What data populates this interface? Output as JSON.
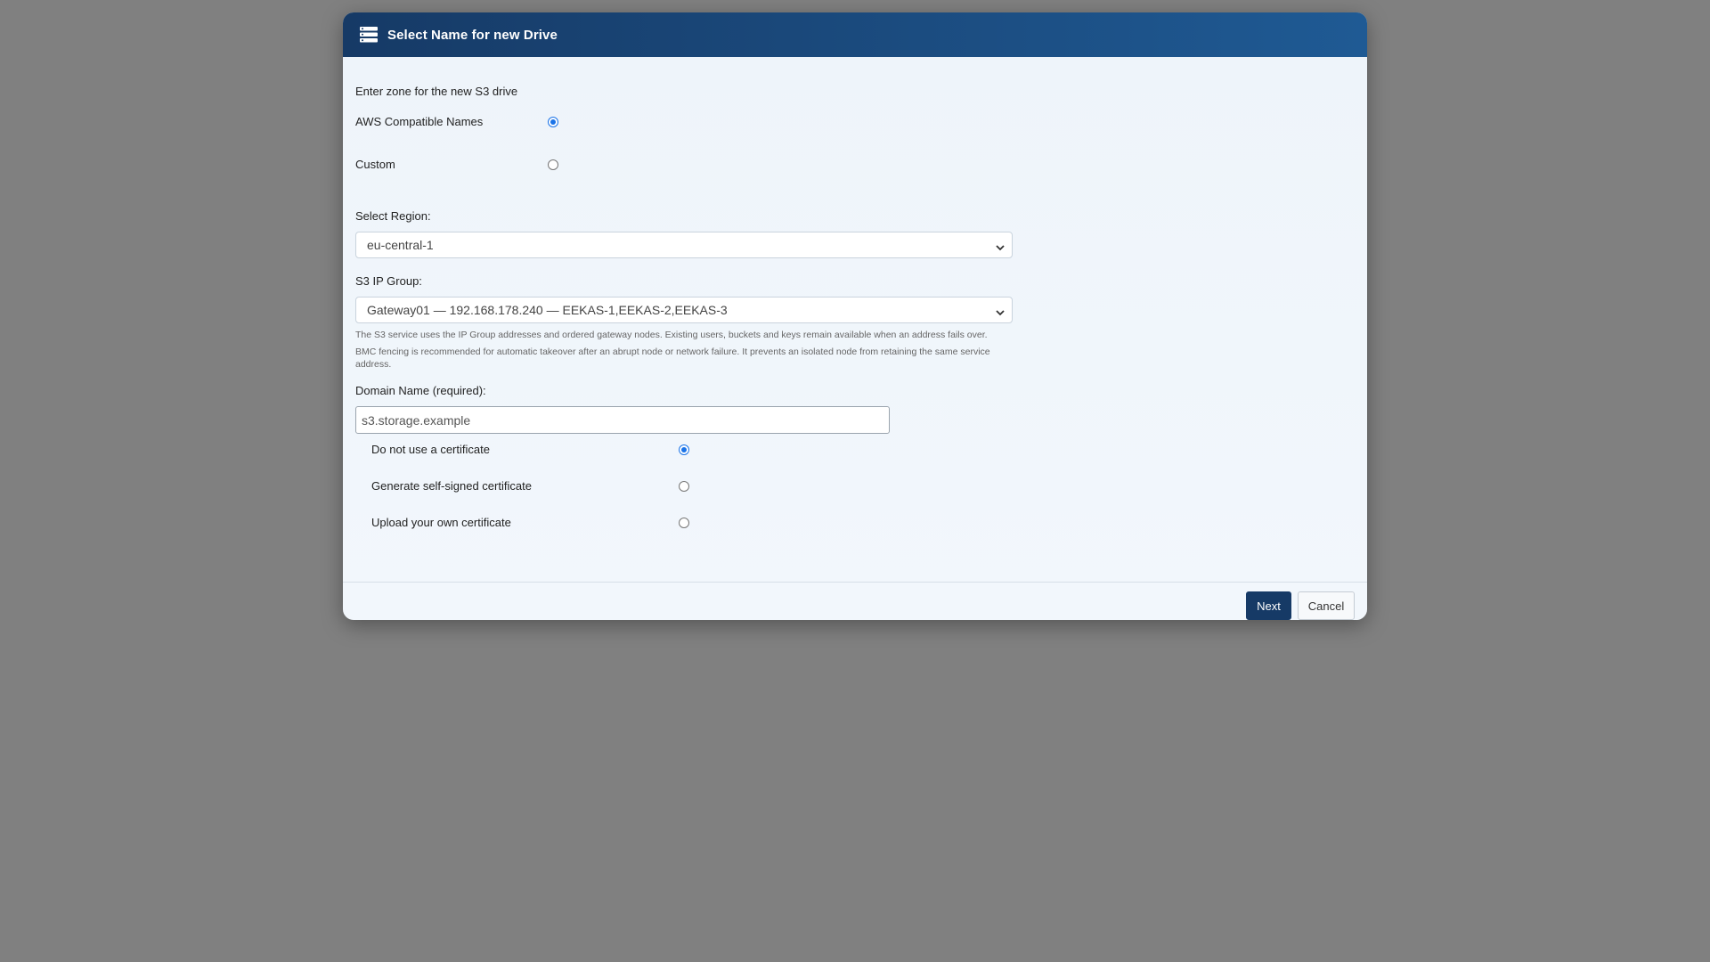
{
  "dialog": {
    "title": "Select Name for new Drive",
    "header_icon": "server-list-icon"
  },
  "zone": {
    "prompt": "Enter zone for the new S3 drive",
    "options": [
      {
        "label": "AWS Compatible Names",
        "selected": true
      },
      {
        "label": "Custom",
        "selected": false
      }
    ]
  },
  "region": {
    "label": "Select Region:",
    "value": "eu-central-1"
  },
  "ip_group": {
    "label": "S3 IP Group:",
    "value": "Gateway01 — 192.168.178.240 — EEKAS-1,EEKAS-2,EEKAS-3",
    "help_1": "The S3 service uses the IP Group addresses and ordered gateway nodes. Existing users, buckets and keys remain available when an address fails over.",
    "help_2": "BMC fencing is recommended for automatic takeover after an abrupt node or network failure. It prevents an isolated node from retaining the same service address."
  },
  "domain": {
    "label": "Domain Name (required):",
    "value": "s3.storage.example"
  },
  "certificate": {
    "options": [
      {
        "label": "Do not use a certificate",
        "selected": true
      },
      {
        "label": "Generate self-signed certificate",
        "selected": false
      },
      {
        "label": "Upload your own certificate",
        "selected": false
      }
    ]
  },
  "footer": {
    "next_label": "Next",
    "cancel_label": "Cancel"
  },
  "colors": {
    "header_start": "#163a66",
    "header_end": "#1f5a94",
    "radio_accent": "#1a73e8",
    "overlay": "#808080"
  }
}
